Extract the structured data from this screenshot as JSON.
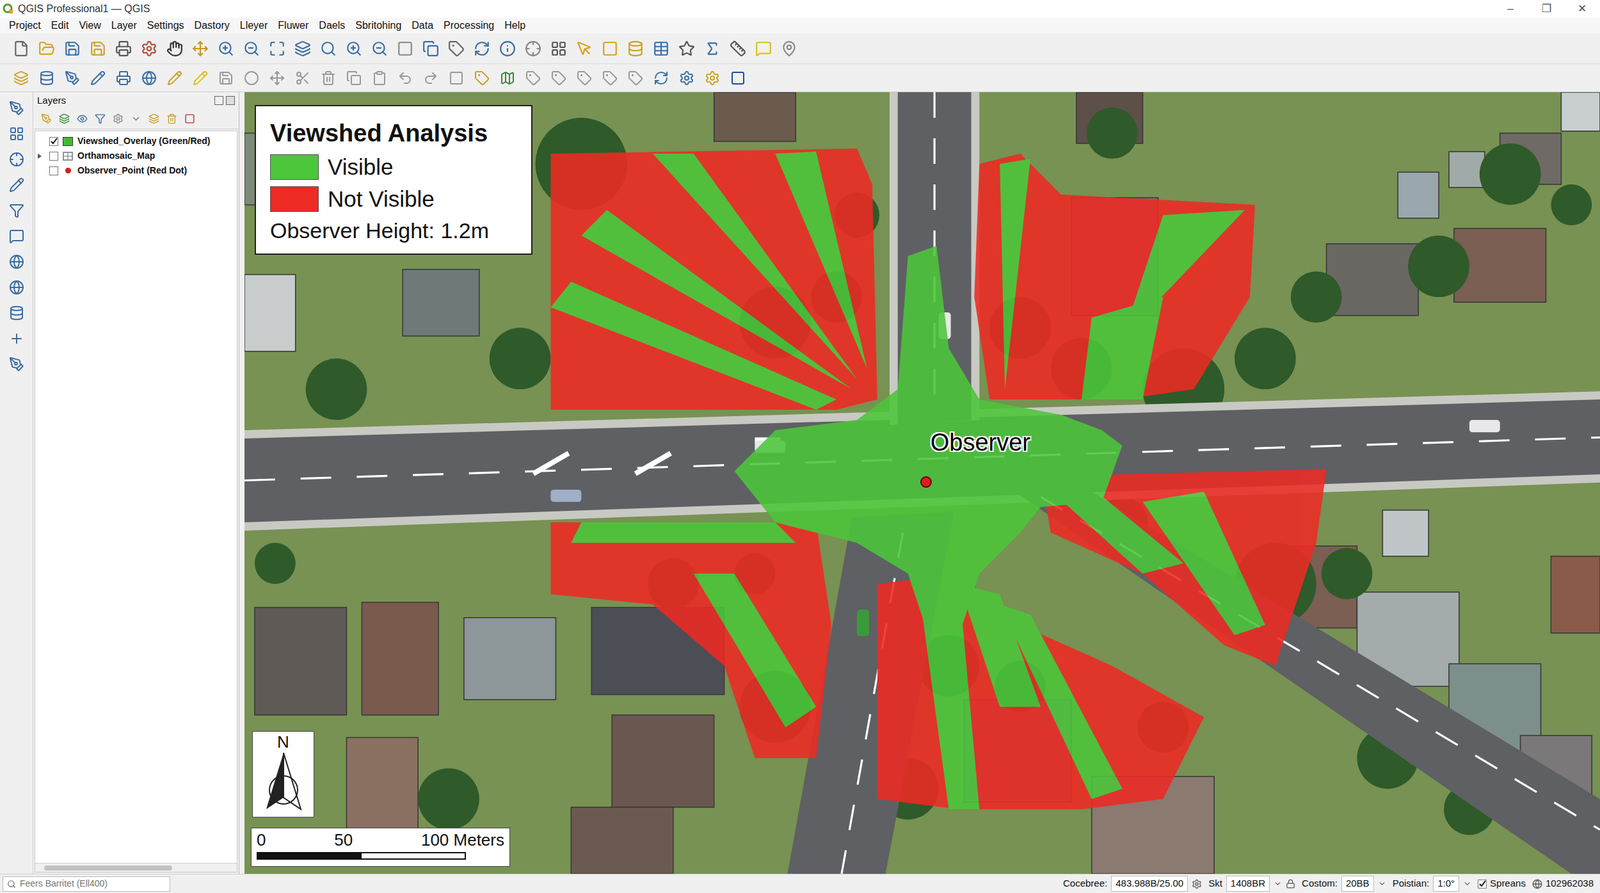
{
  "window": {
    "title": "QGIS Professional1 — QGIS",
    "controls": [
      "–",
      "❐",
      "✕"
    ]
  },
  "menu": [
    "Project",
    "Edit",
    "View",
    "Layer",
    "Settings",
    "Dastory",
    "Lleyer",
    "Fluwer",
    "Daels",
    "Sbritohing",
    "Data",
    "Processing",
    "Help"
  ],
  "layers_panel": {
    "title": "Layers",
    "layers": [
      {
        "name": "Viewshed_Overlay (Green/Red)",
        "kind": "polygon",
        "checked": true,
        "expandable": false,
        "expanded": false,
        "color": "#3cbf2e"
      },
      {
        "name": "Orthamosaic_Map",
        "kind": "raster",
        "checked": false,
        "expandable": true,
        "expanded": false,
        "color": "#6b7280"
      },
      {
        "name": "Observer_Point (Red Dot)",
        "kind": "point",
        "checked": false,
        "expandable": false,
        "expanded": false,
        "color": "#d42020"
      }
    ]
  },
  "legend": {
    "title": "Viewshed Analysis",
    "items": [
      {
        "label": "Visible",
        "color": "#4cc63a"
      },
      {
        "label": "Not Visible",
        "color": "#ee2a24"
      }
    ],
    "note": "Observer Height: 1.2m"
  },
  "observer": {
    "label": "Observer"
  },
  "north_arrow": {
    "label": "N"
  },
  "scale_bar": {
    "ticks": [
      "0",
      "50",
      "100 Meters"
    ]
  },
  "status_bar": {
    "search_placeholder": "Feers Barritet (Ell400)",
    "fields": [
      {
        "label": "Cocebree:",
        "value": "483.988B/25.00"
      },
      {
        "label": "Skt",
        "value": "1408BR"
      },
      {
        "label": "Costom:",
        "value": "20BB"
      },
      {
        "label": "Poistian:",
        "value": "1:0°"
      }
    ],
    "checkbox": {
      "label": "Spreans",
      "checked": true
    },
    "code": "102962038"
  }
}
